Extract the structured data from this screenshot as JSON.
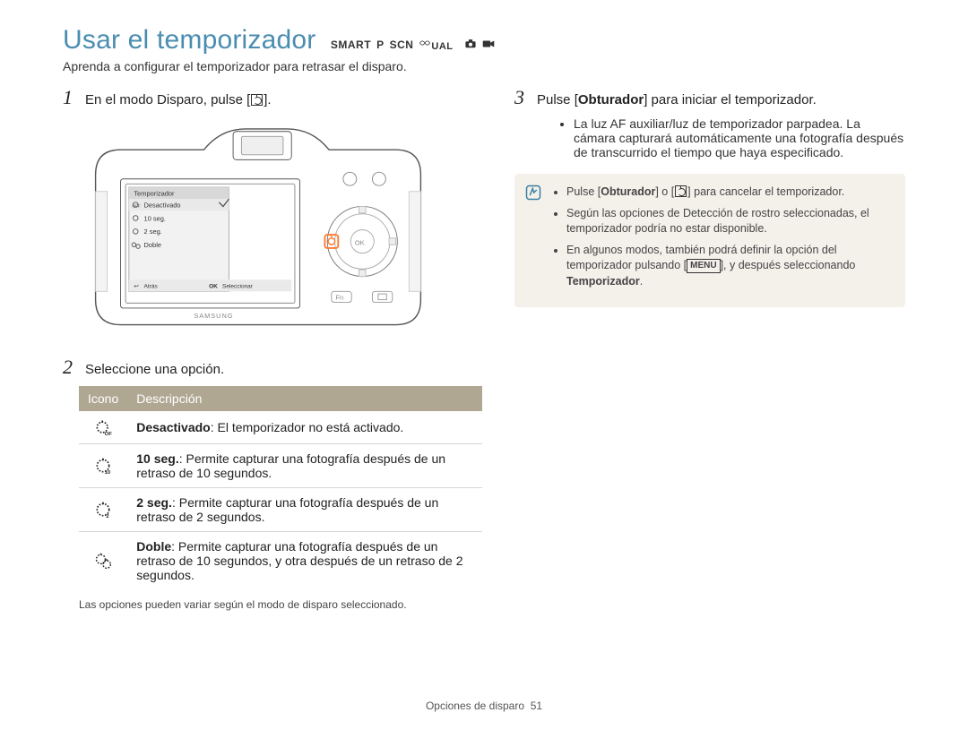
{
  "title": "Usar el temporizador",
  "subtitle": "Aprenda a configurar el temporizador para retrasar el disparo.",
  "modes": {
    "smart": "SMART",
    "p": "P",
    "scn": "SCN",
    "dual": "UAL"
  },
  "left": {
    "step1_pre": "En el modo Disparo, pulse [",
    "step1_post": "].",
    "step2": "Seleccione una opción.",
    "camera_menu": {
      "title": "Temporizador",
      "items": [
        "Desactivado",
        "10 seg.",
        "2 seg.",
        "Doble"
      ],
      "back_label": "Atrás",
      "select_label": "Seleccionar",
      "back_key": "↩",
      "ok_key": "OK"
    },
    "table": {
      "head_icon": "Icono",
      "head_desc": "Descripción",
      "rows": [
        {
          "icon": "off",
          "bold": "Desactivado",
          "text": ": El temporizador no está activado."
        },
        {
          "icon": "10",
          "bold": "10 seg.",
          "text": ": Permite capturar una fotografía después de un retraso de 10 segundos."
        },
        {
          "icon": "2",
          "bold": "2 seg.",
          "text": ": Permite capturar una fotografía después de un retraso de 2 segundos."
        },
        {
          "icon": "double",
          "bold": "Doble",
          "text": ": Permite capturar una fotografía después de un retraso de 10 segundos, y otra después de un retraso de 2 segundos."
        }
      ],
      "footnote": "Las opciones pueden variar según el modo de disparo seleccionado."
    }
  },
  "right": {
    "step3_pre": "Pulse [",
    "step3_bold": "Obturador",
    "step3_post": "] para iniciar el temporizador.",
    "bullets": [
      "La luz AF auxiliar/luz de temporizador parpadea. La cámara capturará automáticamente una fotografía después de transcurrido el tiempo que haya especificado."
    ],
    "note": {
      "items": [
        {
          "pre": "Pulse [",
          "b1": "Obturador",
          "mid": "] o [",
          "icon": true,
          "after": "] para cancelar el temporizador."
        },
        {
          "plain": "Según las opciones de Detección de rostro seleccionadas, el temporizador podría no estar disponible."
        },
        {
          "pre2": "En algunos modos, también podrá definir la opción del temporizador pulsando [",
          "menu": "MENU",
          "mid2": "], y después seleccionando ",
          "b2": "Temporizador",
          "end": "."
        }
      ]
    }
  },
  "footer": {
    "label": "Opciones de disparo",
    "page": "51"
  }
}
